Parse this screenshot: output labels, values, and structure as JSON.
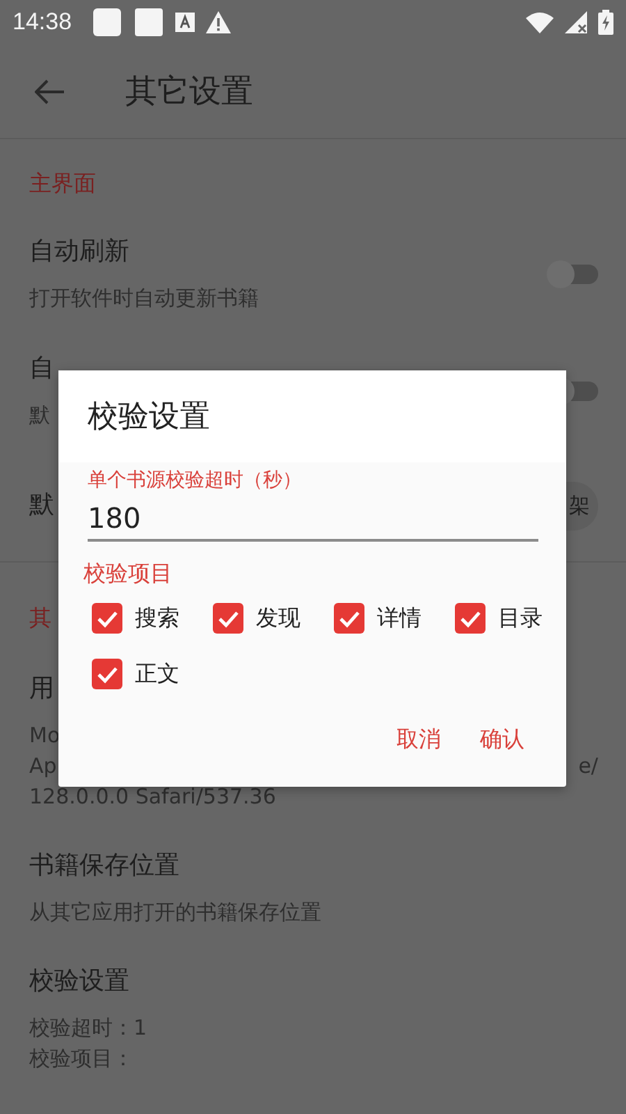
{
  "status_bar": {
    "time": "14:38"
  },
  "app_bar": {
    "title": "其它设置"
  },
  "settings": [
    {
      "kind": "header",
      "title": "主界面"
    },
    {
      "kind": "switch",
      "title": "自动刷新",
      "summary": [
        "打开软件时自动更新书籍"
      ],
      "on": false
    },
    {
      "kind": "switch",
      "title": "自",
      "summary": [
        "默"
      ],
      "on": false
    },
    {
      "kind": "chip",
      "title": "默",
      "chip": "架"
    },
    {
      "kind": "header",
      "title": "其"
    },
    {
      "kind": "text",
      "title": "用",
      "summary": [
        "Mo",
        [
          "Ap",
          "e/"
        ],
        "128.0.0.0 Safari/537.36"
      ]
    },
    {
      "kind": "text",
      "title": "书籍保存位置",
      "summary": [
        "从其它应用打开的书籍保存位置"
      ]
    },
    {
      "kind": "text",
      "title": "校验设置",
      "summary": [
        "校验超时：1",
        "校验项目："
      ]
    }
  ],
  "dialog": {
    "title": "校验设置",
    "timeout_label": "单个书源校验超时（秒）",
    "timeout_value": "180",
    "items_label": "校验项目",
    "items": [
      {
        "label": "搜索",
        "checked": true
      },
      {
        "label": "发现",
        "checked": true
      },
      {
        "label": "详情",
        "checked": true
      },
      {
        "label": "目录",
        "checked": true
      },
      {
        "label": "正文",
        "checked": true
      }
    ],
    "buttons": [
      "取消",
      "确认"
    ]
  }
}
